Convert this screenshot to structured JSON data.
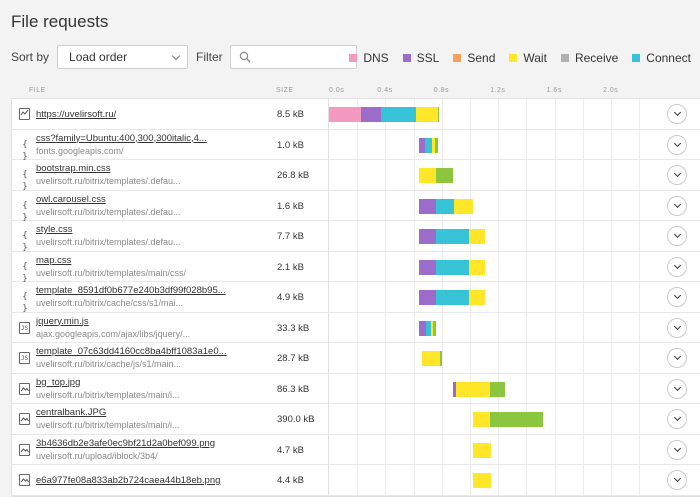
{
  "page": {
    "title": "File requests"
  },
  "controls": {
    "sort_label": "Sort by",
    "sort_value": "Load order",
    "filter_label": "Filter",
    "filter_placeholder": ""
  },
  "legend": [
    {
      "label": "DNS",
      "color": "#f49ac1"
    },
    {
      "label": "SSL",
      "color": "#9b6cc9"
    },
    {
      "label": "Send",
      "color": "#f5a25d"
    },
    {
      "label": "Wait",
      "color": "#ffe629"
    },
    {
      "label": "Receive",
      "color": "#b0b0b0"
    },
    {
      "label": "Connect",
      "color": "#35c3d5"
    }
  ],
  "table": {
    "col_file": "FILE",
    "col_size": "SIZE",
    "ticks": [
      "0.0s",
      "0.4s",
      "0.8s",
      "1.2s",
      "1.6s",
      "2.0s"
    ],
    "timeline_max_s": 2.2
  },
  "colors": {
    "dns": "#f49ac1",
    "ssl": "#9b6cc9",
    "connect": "#35c3d5",
    "wait": "#ffe629",
    "receive": "#8cc63f",
    "send": "#f5a25d"
  },
  "requests": [
    {
      "name": "https://uvelirsoft.ru/",
      "host": "",
      "size": "8.5 kB",
      "icon": "page-icon",
      "timing": [
        [
          "dns",
          0.0,
          0.23
        ],
        [
          "ssl",
          0.23,
          0.37
        ],
        [
          "connect",
          0.37,
          0.62
        ],
        [
          "wait",
          0.62,
          0.77
        ],
        [
          "receive",
          0.77,
          0.78
        ]
      ]
    },
    {
      "name": "css?family=Ubuntu:400,300,300italic,4...",
      "host": "fonts.googleapis.com/",
      "size": "1.0 kB",
      "icon": "code-icon",
      "timing": [
        [
          "ssl",
          0.64,
          0.68
        ],
        [
          "connect",
          0.68,
          0.73
        ],
        [
          "wait",
          0.73,
          0.75
        ],
        [
          "receive",
          0.75,
          0.77
        ]
      ]
    },
    {
      "name": "bootstrap.min.css",
      "host": "uvelirsoft.ru/bitrix/templates/.defau...",
      "size": "26.8 kB",
      "icon": "code-icon",
      "timing": [
        [
          "wait",
          0.64,
          0.76
        ],
        [
          "receive",
          0.76,
          0.88
        ]
      ]
    },
    {
      "name": "owl.carousel.css",
      "host": "uvelirsoft.ru/bitrix/templates/.defau...",
      "size": "1.6 kB",
      "icon": "code-icon",
      "timing": [
        [
          "ssl",
          0.64,
          0.76
        ],
        [
          "connect",
          0.76,
          0.89
        ],
        [
          "wait",
          0.89,
          1.02
        ]
      ]
    },
    {
      "name": "style.css",
      "host": "uvelirsoft.ru/bitrix/templates/.defau...",
      "size": "7.7 kB",
      "icon": "code-icon",
      "timing": [
        [
          "ssl",
          0.64,
          0.76
        ],
        [
          "connect",
          0.76,
          0.99
        ],
        [
          "wait",
          0.99,
          1.11
        ]
      ]
    },
    {
      "name": "map.css",
      "host": "uvelirsoft.ru/bitrix/templates/main/css/",
      "size": "2.1 kB",
      "icon": "code-icon",
      "timing": [
        [
          "ssl",
          0.64,
          0.76
        ],
        [
          "connect",
          0.76,
          0.99
        ],
        [
          "wait",
          0.99,
          1.11
        ]
      ]
    },
    {
      "name": "template_8591df0b677e240b3df99f028b95...",
      "host": "uvelirsoft.ru/bitrix/cache/css/s1/mai...",
      "size": "4.9 kB",
      "icon": "code-icon",
      "timing": [
        [
          "ssl",
          0.64,
          0.76
        ],
        [
          "connect",
          0.76,
          0.99
        ],
        [
          "wait",
          0.99,
          1.11
        ]
      ]
    },
    {
      "name": "jquery.min.js",
      "host": "ajax.googleapis.com/ajax/libs/jquery/...",
      "size": "33.3 kB",
      "icon": "script-icon",
      "timing": [
        [
          "ssl",
          0.64,
          0.69
        ],
        [
          "connect",
          0.69,
          0.72
        ],
        [
          "wait",
          0.72,
          0.74
        ],
        [
          "receive",
          0.74,
          0.76
        ]
      ]
    },
    {
      "name": "template_07c63dd4160cc8ba4bff1083a1e0...",
      "host": "uvelirsoft.ru/bitrix/cache/js/s1/main...",
      "size": "28.7 kB",
      "icon": "script-icon",
      "timing": [
        [
          "wait",
          0.66,
          0.79
        ],
        [
          "receive",
          0.79,
          0.8
        ]
      ]
    },
    {
      "name": "bg_top.jpg",
      "host": "uvelirsoft.ru/bitrix/templates/main/i...",
      "size": "86.3 kB",
      "icon": "image-icon",
      "timing": [
        [
          "ssl",
          0.88,
          0.9
        ],
        [
          "wait",
          0.9,
          1.14
        ],
        [
          "receive",
          1.14,
          1.25
        ]
      ]
    },
    {
      "name": "centralbank.JPG",
      "host": "uvelirsoft.ru/bitrix/templates/main/i...",
      "size": "390.0 kB",
      "icon": "image-icon",
      "timing": [
        [
          "wait",
          1.02,
          1.14
        ],
        [
          "receive",
          1.14,
          1.52
        ]
      ]
    },
    {
      "name": "3b4636db2e3afe0ec9bf21d2a0bef099.png",
      "host": "uvelirsoft.ru/upload/iblock/3b4/",
      "size": "4.7 kB",
      "icon": "image-icon",
      "timing": [
        [
          "wait",
          1.02,
          1.15
        ]
      ]
    },
    {
      "name": "e6a977fe08a833ab2b724caea44b18eb.png",
      "host": "",
      "size": "4.4 kB",
      "icon": "image-icon",
      "timing": [
        [
          "wait",
          1.02,
          1.15
        ]
      ]
    }
  ]
}
